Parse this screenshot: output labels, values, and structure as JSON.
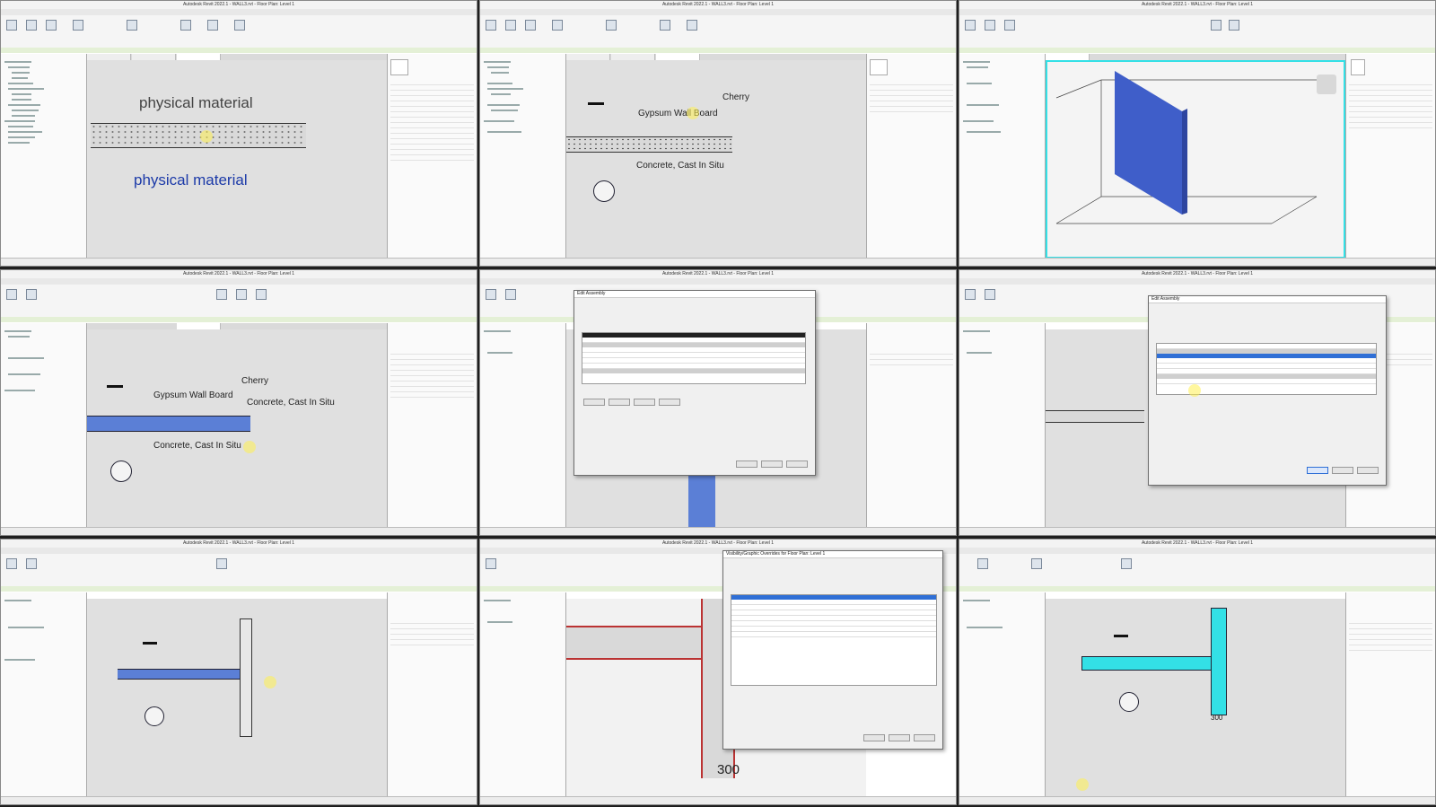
{
  "app": {
    "title": "Autodesk Revit 2022.1 - WALL3.rvt - Floor Plan: Level 1"
  },
  "panels": [
    {
      "labels": [
        "physical material",
        "physical material"
      ]
    },
    {
      "labels": [
        "Cherry",
        "Gypsum Wall Board",
        "Concrete, Cast In Situ"
      ]
    },
    {
      "labels": []
    },
    {
      "labels": [
        "Cherry",
        "Gypsum Wall Board",
        "Concrete, Cast In Situ",
        "Concrete, Cast In Situ"
      ]
    },
    {
      "dialog_title": "Edit Assembly",
      "labels": []
    },
    {
      "dialog_title": "Edit Assembly",
      "labels": []
    },
    {
      "labels": []
    },
    {
      "dialog_title": "Visibility/Graphic Overrides for Floor Plan: Level 1",
      "labels": [
        "300"
      ]
    },
    {
      "labels": [
        "300"
      ]
    }
  ],
  "colors": {
    "wall_blue": "#5b7fd6",
    "cyan_highlight": "#33e0e6",
    "ribbon_green": "#e4f0d6"
  }
}
